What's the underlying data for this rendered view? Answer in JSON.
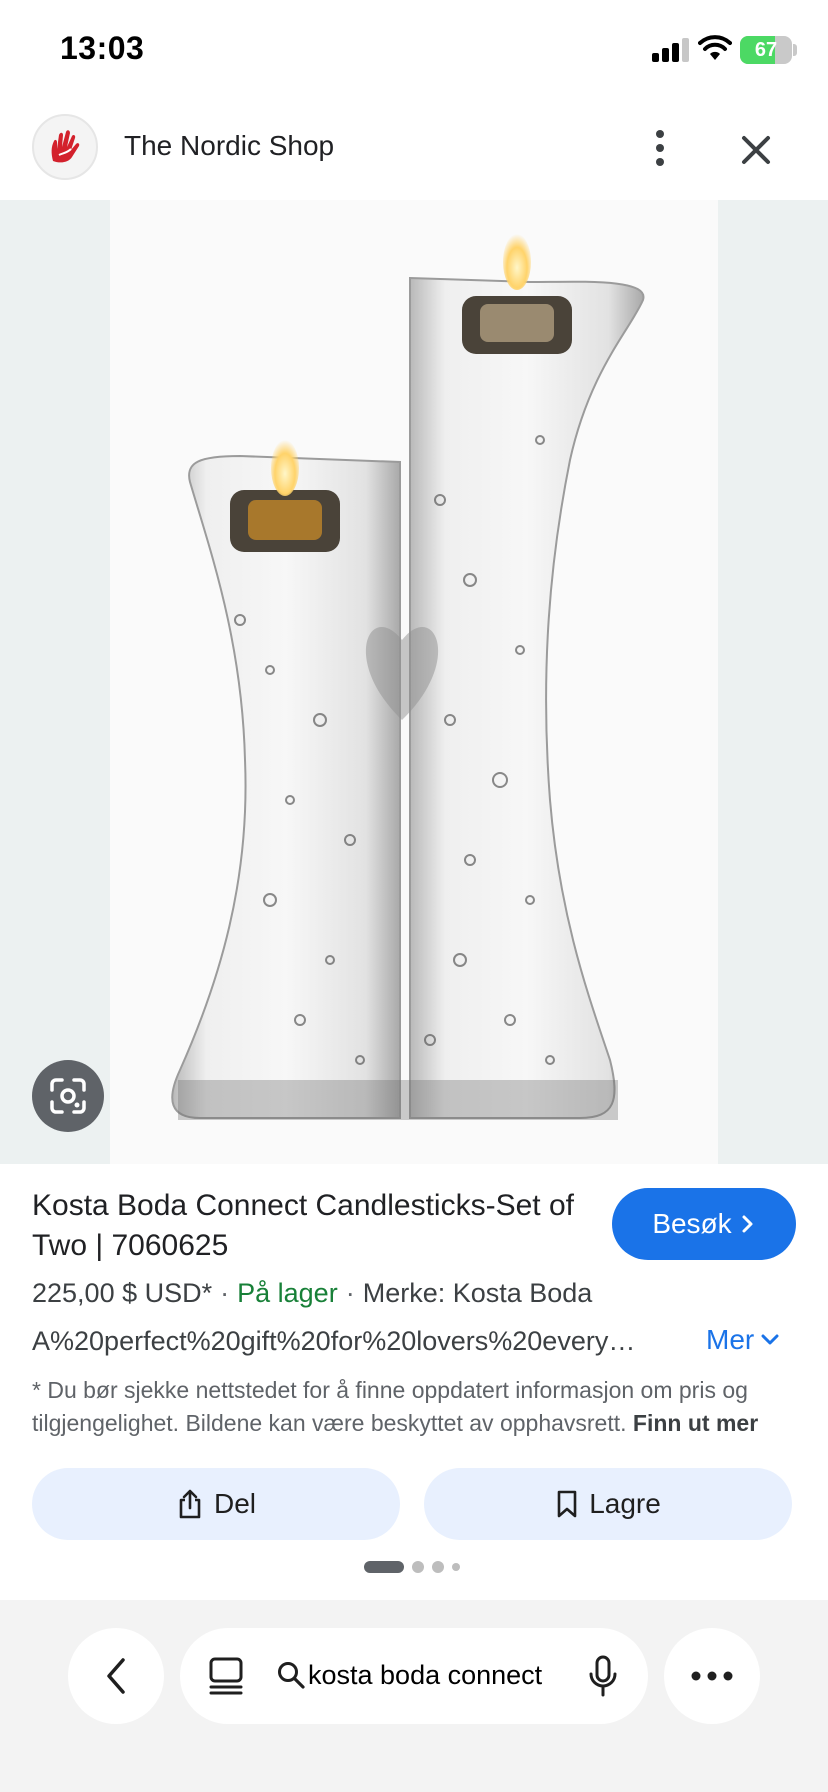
{
  "status_bar": {
    "time": "13:03",
    "battery_percent": 67,
    "battery_label": "67"
  },
  "header": {
    "site_name": "The Nordic Shop",
    "logo_icon": "red-hand-logo-icon",
    "more_icon": "more-vert-icon",
    "close_icon": "close-icon"
  },
  "image": {
    "lens_icon": "google-lens-icon"
  },
  "product": {
    "title": "Kosta Boda Connect Candlesticks-Set of Two | 7060625",
    "visit_label": "Besøk",
    "price": "225,00 $ USD*",
    "availability": "På lager",
    "brand": "Merke: Kosta Boda",
    "description": "A%20perfect%20gift%20for%20lovers%20every…",
    "more_label": "Mer",
    "disclaimer": "* Du bør sjekke nettstedet for å finne oppdatert informasjon om pris og tilgjengelighet. Bildene kan være beskyttet av opphavsrett.",
    "learn_more": "Finn ut mer"
  },
  "actions": {
    "share_label": "Del",
    "save_label": "Lagre"
  },
  "pager": {
    "active_index": 0,
    "count": 4
  },
  "bottom_bar": {
    "query": "kosta boda connect"
  },
  "colors": {
    "accent": "#1a73e8",
    "in_stock": "#188038",
    "pill_bg": "#e8f0fe",
    "logo_red": "#d3212c"
  }
}
